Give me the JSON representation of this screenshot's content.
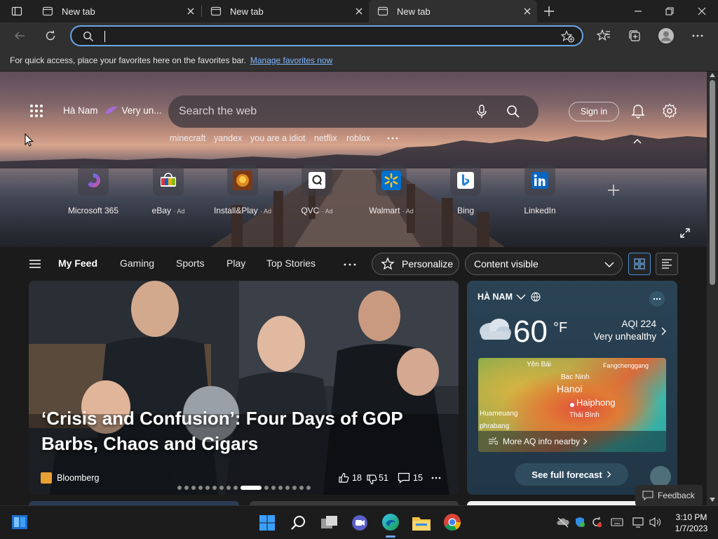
{
  "tabs": [
    {
      "label": "New tab"
    },
    {
      "label": "New tab"
    },
    {
      "label": "New tab"
    }
  ],
  "favorites_bar": {
    "message": "For quick access, place your favorites here on the favorites bar.",
    "link": "Manage favorites now"
  },
  "ntp": {
    "location": "Hà Nam",
    "aqi_short": "Very un...",
    "search_placeholder": "Search the web",
    "suggestions": [
      "minecraft",
      "yandex",
      "you are a idiot",
      "netflix",
      "roblox"
    ],
    "sign_in": "Sign in",
    "tiles": [
      {
        "label": "Microsoft 365",
        "ad": ""
      },
      {
        "label": "eBay",
        "ad": "· Ad"
      },
      {
        "label": "Install&Play",
        "ad": "· Ad"
      },
      {
        "label": "QVC",
        "ad": "· Ad"
      },
      {
        "label": "Walmart",
        "ad": "· Ad"
      },
      {
        "label": "Bing",
        "ad": ""
      },
      {
        "label": "LinkedIn",
        "ad": ""
      }
    ]
  },
  "feed_nav": {
    "items": [
      "My Feed",
      "Gaming",
      "Sports",
      "Play",
      "Top Stories"
    ],
    "personalize": "Personalize",
    "content_visible": "Content visible"
  },
  "news_card": {
    "headline": "‘Crisis and Confusion’: Four Days of GOP Barbs, Chaos and Cigars",
    "source": "Bloomberg",
    "likes": "18",
    "dislikes": "51",
    "comments": "15"
  },
  "weather": {
    "location": "HÀ NAM",
    "temp": "60",
    "unit": "°F",
    "aqi": "AQI 224",
    "aqi_status": "Very unhealthy",
    "map_labels": [
      "Yên Bái",
      "Fangchenggang",
      "Bac Ninh",
      "Hanoi",
      "Haiphong",
      "Huameuang",
      "Thái Bình",
      "phrabang"
    ],
    "more_aq": "More AQ info nearby",
    "forecast": "See full forecast"
  },
  "feedback": "Feedback",
  "taskbar": {
    "time": "3:10 PM",
    "date": "1/7/2023"
  },
  "colors": {
    "accent": "#6aa5e6",
    "link": "#7fb6ff",
    "chrome_bg": "#202020",
    "toolbar_bg": "#303030"
  }
}
